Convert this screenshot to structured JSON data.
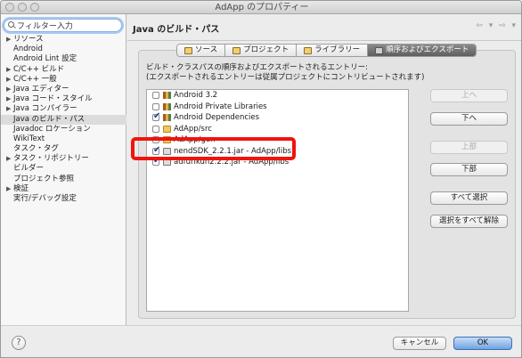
{
  "window": {
    "title": "AdApp のプロパティー"
  },
  "sidebar": {
    "filter_value": "フィルター入力",
    "items": [
      {
        "label": "リソース",
        "arrow": "▶"
      },
      {
        "label": "Android",
        "arrow": ""
      },
      {
        "label": "Android Lint 設定",
        "arrow": ""
      },
      {
        "label": "C/C++ ビルド",
        "arrow": "▶"
      },
      {
        "label": "C/C++ 一般",
        "arrow": "▶"
      },
      {
        "label": "Java エディター",
        "arrow": "▶"
      },
      {
        "label": "Java コード・スタイル",
        "arrow": "▶"
      },
      {
        "label": "Java コンパイラー",
        "arrow": "▶"
      },
      {
        "label": "Java のビルド・パス",
        "arrow": ""
      },
      {
        "label": "Javadoc ロケーション",
        "arrow": ""
      },
      {
        "label": "WikiText",
        "arrow": ""
      },
      {
        "label": "タスク・タグ",
        "arrow": ""
      },
      {
        "label": "タスク・リポジトリー",
        "arrow": "▶"
      },
      {
        "label": "ビルダー",
        "arrow": ""
      },
      {
        "label": "プロジェクト参照",
        "arrow": ""
      },
      {
        "label": "検証",
        "arrow": "▶"
      },
      {
        "label": "実行/デバッグ設定",
        "arrow": ""
      }
    ]
  },
  "main": {
    "title": "Java のビルド・パス",
    "nav": "⇦ ▾ ⇨ ▾",
    "tabs": [
      {
        "label": "ソース"
      },
      {
        "label": "プロジェクト"
      },
      {
        "label": "ライブラリー"
      },
      {
        "label": "順序およびエクスポート"
      }
    ],
    "description_line1": "ビルド・クラスパスの順序およびエクスポートされるエントリー:",
    "description_line2": "(エクスポートされるエントリーは従属プロジェクトにコントリビュートされます)",
    "entries": [
      {
        "label": "Android 3.2",
        "checked": false,
        "icon": "library-icon"
      },
      {
        "label": "Android Private Libraries",
        "checked": false,
        "icon": "library-icon"
      },
      {
        "label": "Android Dependencies",
        "checked": true,
        "icon": "library-icon"
      },
      {
        "label": "AdApp/src",
        "checked": false,
        "icon": "folder-icon"
      },
      {
        "label": "AdApp/gen",
        "checked": false,
        "icon": "folder-icon"
      },
      {
        "label": "nendSDK_2.2.1.jar - AdApp/libs",
        "checked": true,
        "icon": "jar-icon"
      },
      {
        "label": "adfurikun2.2.2.jar - AdApp/libs",
        "checked": true,
        "icon": "jar-icon"
      }
    ],
    "buttons": {
      "up": "上へ",
      "down": "下へ",
      "top": "上部",
      "bottom": "下部",
      "select_all": "すべて選択",
      "deselect_all": "選択をすべて解除"
    }
  },
  "footer": {
    "help": "?",
    "cancel": "キャンセル",
    "ok": "OK"
  }
}
